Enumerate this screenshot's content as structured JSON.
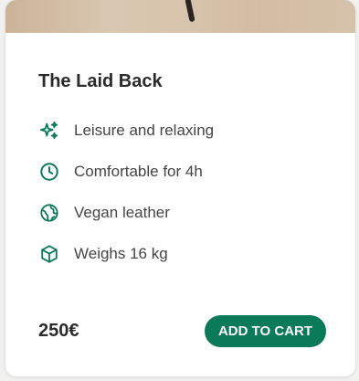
{
  "product": {
    "name": "The Laid Back",
    "price": "250€",
    "add_to_cart_label": "ADD TO CART",
    "features": [
      {
        "icon": "sparkles-icon",
        "label": "Leisure and relaxing"
      },
      {
        "icon": "clock-icon",
        "label": "Comfortable for 4h"
      },
      {
        "icon": "globe-icon",
        "label": "Vegan leather"
      },
      {
        "icon": "cube-icon",
        "label": "Weighs 16 kg"
      }
    ]
  },
  "colors": {
    "accent": "#0b7a58",
    "background": "#f1f1f0",
    "card": "#ffffff",
    "text": "#2b2b2b"
  }
}
